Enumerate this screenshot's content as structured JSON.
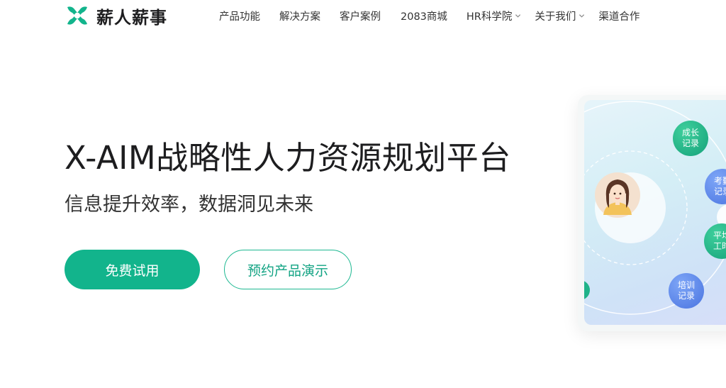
{
  "header": {
    "brand_name": "薪人薪事",
    "logo_icon": "xinrenxinshi-logo-icon",
    "brand_color": "#12b48c",
    "nav": [
      {
        "label": "产品功能",
        "has_dropdown": false
      },
      {
        "label": "解决方案",
        "has_dropdown": false
      },
      {
        "label": "客户案例",
        "has_dropdown": false
      },
      {
        "label": "2083商城",
        "has_dropdown": false
      },
      {
        "label": "HR科学院",
        "has_dropdown": true
      },
      {
        "label": "关于我们",
        "has_dropdown": true
      },
      {
        "label": "渠道合作",
        "has_dropdown": false
      }
    ]
  },
  "hero": {
    "title": "X-AIM战略性人力资源规划平台",
    "subtitle": "信息提升效率，数据洞见未来",
    "primary_button": "免费试用",
    "secondary_button": "预约产品演示"
  },
  "illustration": {
    "avatar_icon": "employee-avatar-icon",
    "bubbles": [
      {
        "label": "成长\n记录",
        "color": "green"
      },
      {
        "label": "考勤\n记录",
        "color": "blue"
      },
      {
        "label": "平均\n工时",
        "color": "green"
      },
      {
        "label": "培训\n记录",
        "color": "blue"
      }
    ]
  }
}
